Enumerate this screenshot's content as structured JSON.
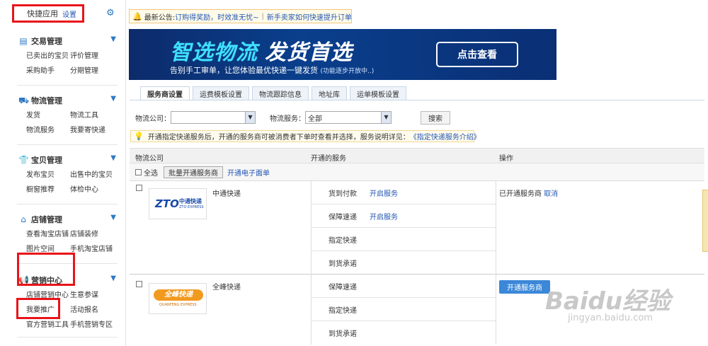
{
  "sidebar": {
    "quick_title": "快捷应用",
    "quick_settings": "设置",
    "sections": [
      {
        "title": "交易管理",
        "icon": "trade-icon",
        "rows": [
          [
            "已卖出的宝贝",
            "评价管理"
          ],
          [
            "采购助手",
            "分期管理"
          ]
        ]
      },
      {
        "title": "物流管理",
        "icon": "truck-icon",
        "rows": [
          [
            "发货",
            "物流工具"
          ],
          [
            "物流服务",
            "我要寄快递"
          ]
        ]
      },
      {
        "title": "宝贝管理",
        "icon": "shirt-icon",
        "rows": [
          [
            "发布宝贝",
            "出售中的宝贝"
          ],
          [
            "橱窗推荐",
            "体检中心"
          ]
        ]
      },
      {
        "title": "店铺管理",
        "icon": "store-icon",
        "rows": [
          [
            "查看淘宝店铺",
            "店铺装修"
          ],
          [
            "图片空间",
            "手机淘宝店铺"
          ]
        ]
      },
      {
        "title": "营销中心",
        "icon": "megaphone-icon",
        "rows": [
          [
            "店铺营销中心",
            "生意参谋"
          ],
          [
            "我要推广",
            "活动报名"
          ],
          [
            "官方营销工具",
            "手机营销专区"
          ]
        ]
      }
    ]
  },
  "announce": {
    "label": "最新公告:",
    "link1": "订购得奖励，时效准无忧~",
    "sep": "|",
    "link2": "新手卖家如何快速提升订单"
  },
  "banner": {
    "title1": "智选物流",
    "title2": "发货首选",
    "subtitle": "告别手工审单，让您体验最优快递一键发货",
    "note": "(功能逐步开放中..)",
    "button": "点击查看"
  },
  "tabs": [
    "服务商设置",
    "运费模板设置",
    "物流跟踪信息",
    "地址库",
    "运单模板设置"
  ],
  "filters": {
    "company_label": "物流公司：",
    "company_value": "",
    "service_label": "物流服务：",
    "service_value": "全部",
    "search_button": "搜索"
  },
  "tip": {
    "text": "开通指定快递服务后，开通的服务商可被消费者下单时查看并选择，服务说明详见：",
    "link": "《指定快递服务介绍》"
  },
  "table": {
    "headers": [
      "物流公司",
      "开通的服务",
      "操作"
    ],
    "select_all": "全选",
    "batch_button": "批量开通服务商",
    "e_waybill": "开通电子面单",
    "rows": [
      {
        "name": "中通快递",
        "logo_text": "ZTO",
        "logo_sub": "中通快递",
        "logo_en": "ZTO EXPRESS",
        "services": [
          {
            "name": "货到付款",
            "action": "开启服务"
          },
          {
            "name": "保障速递",
            "action": "开启服务"
          },
          {
            "name": "指定快递",
            "action": ""
          },
          {
            "name": "到货承诺",
            "action": ""
          }
        ],
        "status": "已开通服务商",
        "cancel": "取消"
      },
      {
        "name": "全峰快递",
        "logo_text": "全峰快递",
        "logo_en": "QUANFENG EXPRESS",
        "services": [
          {
            "name": "保障速递",
            "action": ""
          },
          {
            "name": "指定快递",
            "action": ""
          },
          {
            "name": "到货承诺",
            "action": ""
          }
        ],
        "open_button": "开通服务商"
      }
    ]
  },
  "watermark": {
    "brand": "Baidu经验",
    "url": "jingyan.baidu.com"
  },
  "colors": {
    "link": "#2457b3",
    "accent_blue": "#2f78c4",
    "highlight_red": "#e8141a",
    "primary_button": "#3b87d8"
  }
}
